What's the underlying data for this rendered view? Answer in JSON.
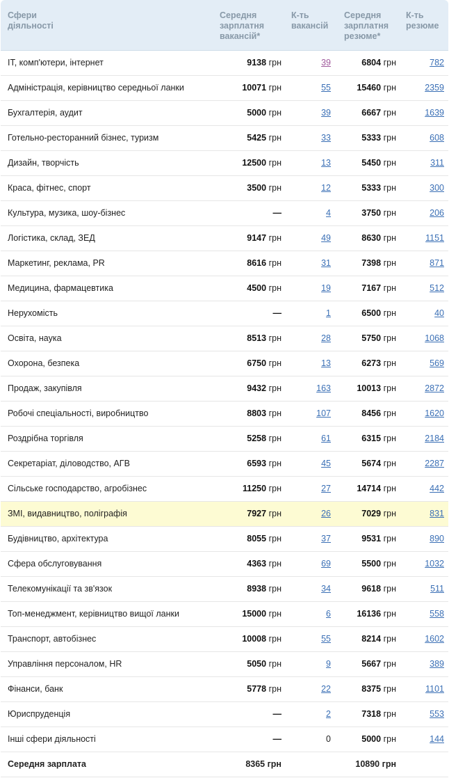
{
  "header": {
    "col_sphere": "Сфери\nдіяльності",
    "col_vac_salary": "Середня зарплатня вакансій*",
    "col_vac_count": "К-ть вакансій",
    "col_res_salary": "Середня зарплатня резюме*",
    "col_res_count": "К-ть резюме"
  },
  "currency": "грн",
  "rows": [
    {
      "name": "IT, комп'ютери, інтернет",
      "vac_salary": "9138",
      "vac_count": "39",
      "res_salary": "6804",
      "res_count": "782",
      "visited": true
    },
    {
      "name": "Адміністрація, керівництво середньої ланки",
      "vac_salary": "10071",
      "vac_count": "55",
      "res_salary": "15460",
      "res_count": "2359"
    },
    {
      "name": "Бухгалтерія, аудит",
      "vac_salary": "5000",
      "vac_count": "39",
      "res_salary": "6667",
      "res_count": "1639"
    },
    {
      "name": "Готельно-ресторанний бізнес, туризм",
      "vac_salary": "5425",
      "vac_count": "33",
      "res_salary": "5333",
      "res_count": "608"
    },
    {
      "name": "Дизайн, творчість",
      "vac_salary": "12500",
      "vac_count": "13",
      "res_salary": "5450",
      "res_count": "311"
    },
    {
      "name": "Краса, фітнес, спорт",
      "vac_salary": "3500",
      "vac_count": "12",
      "res_salary": "5333",
      "res_count": "300"
    },
    {
      "name": "Культура, музика, шоу-бізнес",
      "vac_salary": "—",
      "vac_count": "4",
      "res_salary": "3750",
      "res_count": "206"
    },
    {
      "name": "Логістика, склад, ЗЕД",
      "vac_salary": "9147",
      "vac_count": "49",
      "res_salary": "8630",
      "res_count": "1151"
    },
    {
      "name": "Маркетинг, реклама, PR",
      "vac_salary": "8616",
      "vac_count": "31",
      "res_salary": "7398",
      "res_count": "871"
    },
    {
      "name": "Медицина, фармацевтика",
      "vac_salary": "4500",
      "vac_count": "19",
      "res_salary": "7167",
      "res_count": "512"
    },
    {
      "name": "Нерухомість",
      "vac_salary": "—",
      "vac_count": "1",
      "res_salary": "6500",
      "res_count": "40"
    },
    {
      "name": "Освіта, наука",
      "vac_salary": "8513",
      "vac_count": "28",
      "res_salary": "5750",
      "res_count": "1068"
    },
    {
      "name": "Охорона, безпека",
      "vac_salary": "6750",
      "vac_count": "13",
      "res_salary": "6273",
      "res_count": "569"
    },
    {
      "name": "Продаж, закупівля",
      "vac_salary": "9432",
      "vac_count": "163",
      "res_salary": "10013",
      "res_count": "2872"
    },
    {
      "name": "Робочі спеціальності, виробництво",
      "vac_salary": "8803",
      "vac_count": "107",
      "res_salary": "8456",
      "res_count": "1620"
    },
    {
      "name": "Роздрібна торгівля",
      "vac_salary": "5258",
      "vac_count": "61",
      "res_salary": "6315",
      "res_count": "2184"
    },
    {
      "name": "Секретаріат, діловодство, АГВ",
      "vac_salary": "6593",
      "vac_count": "45",
      "res_salary": "5674",
      "res_count": "2287"
    },
    {
      "name": "Сільське господарство, агробізнес",
      "vac_salary": "11250",
      "vac_count": "27",
      "res_salary": "14714",
      "res_count": "442"
    },
    {
      "name": "ЗМІ, видавництво, поліграфія",
      "vac_salary": "7927",
      "vac_count": "26",
      "res_salary": "7029",
      "res_count": "831",
      "highlighted": true
    },
    {
      "name": "Будівництво, архітектура",
      "vac_salary": "8055",
      "vac_count": "37",
      "res_salary": "9531",
      "res_count": "890"
    },
    {
      "name": "Сфера обслуговування",
      "vac_salary": "4363",
      "vac_count": "69",
      "res_salary": "5500",
      "res_count": "1032"
    },
    {
      "name": "Телекомунікації та зв'язок",
      "vac_salary": "8938",
      "vac_count": "34",
      "res_salary": "9618",
      "res_count": "511"
    },
    {
      "name": "Топ-менеджмент, керівництво вищої ланки",
      "vac_salary": "15000",
      "vac_count": "6",
      "res_salary": "16136",
      "res_count": "558"
    },
    {
      "name": "Транспорт, автобізнес",
      "vac_salary": "10008",
      "vac_count": "55",
      "res_salary": "8214",
      "res_count": "1602"
    },
    {
      "name": "Управління персоналом, HR",
      "vac_salary": "5050",
      "vac_count": "9",
      "res_salary": "5667",
      "res_count": "389"
    },
    {
      "name": "Фінанси, банк",
      "vac_salary": "5778",
      "vac_count": "22",
      "res_salary": "8375",
      "res_count": "1101"
    },
    {
      "name": "Юриспруденція",
      "vac_salary": "—",
      "vac_count": "2",
      "res_salary": "7318",
      "res_count": "553"
    },
    {
      "name": "Інші сфери діяльності",
      "vac_salary": "—",
      "vac_count": "0",
      "res_salary": "5000",
      "res_count": "144",
      "vac_count_plain": true
    }
  ],
  "total": {
    "label": "Середня зарплата",
    "vac_salary": "8365 грн",
    "res_salary": "10890 грн"
  },
  "colors": {
    "header_bg": "#e3edf6",
    "header_text": "#8899a8",
    "link": "#3a6fb5",
    "visited_link": "#a05a9c",
    "highlight_row": "#fdfbd3"
  }
}
